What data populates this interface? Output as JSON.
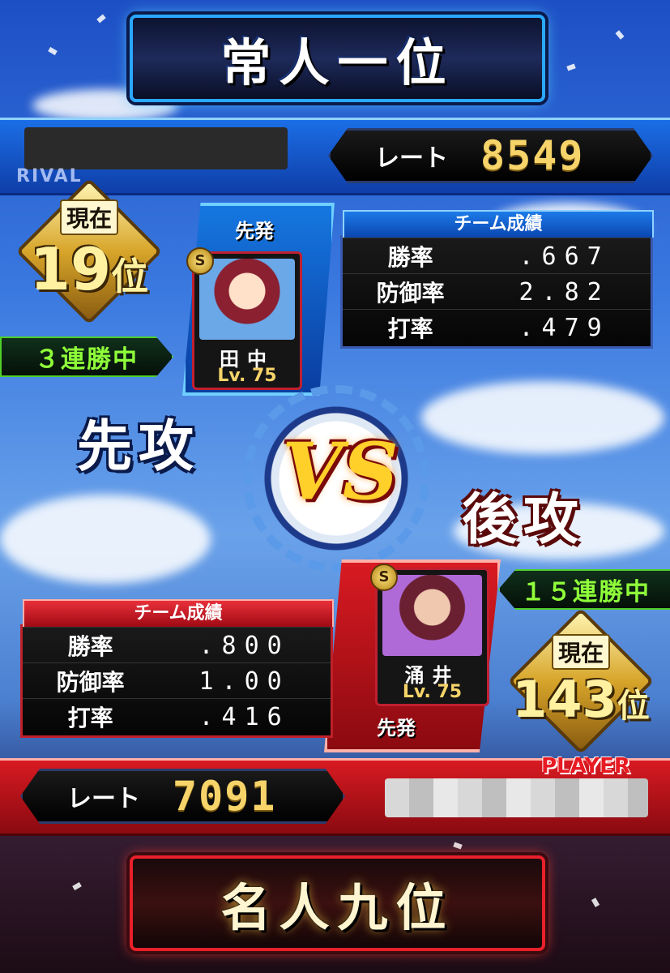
{
  "opponent": {
    "tag": "RIVAL",
    "rank_title": "常人一位",
    "rate_label": "レート",
    "rate_value": "8549",
    "rank_label": "現在",
    "rank_number": "19",
    "rank_unit": "位",
    "streak": "３連勝中",
    "pitcher_role": "先発",
    "pitcher_name": "田中",
    "pitcher_level": "Lv. 75",
    "badge": "S",
    "stats_title": "チーム成績",
    "stats": [
      {
        "label": "勝率",
        "value": ".667"
      },
      {
        "label": "防御率",
        "value": "2.82"
      },
      {
        "label": "打率",
        "value": ".479"
      }
    ],
    "batting_order": "先攻"
  },
  "vs_label": "VS",
  "player": {
    "tag": "PLAYER",
    "rank_title": "名人九位",
    "rate_label": "レート",
    "rate_value": "7091",
    "rank_label": "現在",
    "rank_number": "143",
    "rank_unit": "位",
    "streak": "１５連勝中",
    "pitcher_role": "先発",
    "pitcher_name": "涌井",
    "pitcher_level": "Lv. 75",
    "badge": "S",
    "stats_title": "チーム成績",
    "stats": [
      {
        "label": "勝率",
        "value": ".800"
      },
      {
        "label": "防御率",
        "value": "1.00"
      },
      {
        "label": "打率",
        "value": ".416"
      }
    ],
    "batting_order": "後攻"
  },
  "colors": {
    "opponent_accent": "#1b6ee6",
    "player_accent": "#d81a22",
    "rate_gold": "#f6d46a",
    "streak_green": "#8fff3a"
  }
}
